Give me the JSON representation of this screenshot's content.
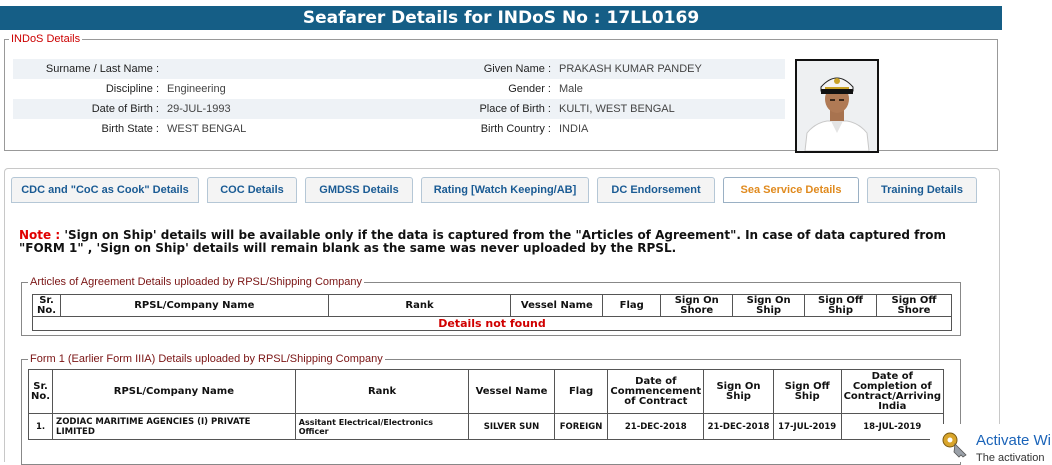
{
  "page_title": "Seafarer Details for INDoS No : 17LL0169",
  "indos": {
    "legend": "INDoS Details",
    "rows": [
      {
        "l1": "Surname / Last Name :",
        "v1": "",
        "l2": "Given Name :",
        "v2": "PRAKASH KUMAR PANDEY"
      },
      {
        "l1": "Discipline :",
        "v1": "Engineering",
        "l2": "Gender :",
        "v2": "Male"
      },
      {
        "l1": "Date of Birth :",
        "v1": "29-JUL-1993",
        "l2": "Place of Birth :",
        "v2": "KULTI, WEST BENGAL"
      },
      {
        "l1": "Birth State :",
        "v1": "WEST BENGAL",
        "l2": "Birth Country :",
        "v2": "INDIA"
      }
    ]
  },
  "tabs": [
    {
      "label": "CDC and \"CoC as Cook\" Details"
    },
    {
      "label": "COC Details"
    },
    {
      "label": "GMDSS Details"
    },
    {
      "label": "Rating [Watch Keeping/AB]"
    },
    {
      "label": "DC Endorsement"
    },
    {
      "label": "Sea Service Details"
    },
    {
      "label": "Training Details"
    }
  ],
  "active_tab": "Sea Service Details",
  "note": {
    "prefix": "Note :",
    "text": " 'Sign on Ship' details will be available only if the data is captured from the \"Articles of Agreement\". In case of data captured from \"FORM 1\" , 'Sign on Ship' details will remain blank as the same was never uploaded by the RPSL."
  },
  "articles": {
    "legend": "Articles of Agreement Details uploaded by RPSL/Shipping Company",
    "headers": [
      "Sr. No.",
      "RPSL/Company Name",
      "Rank",
      "Vessel Name",
      "Flag",
      "Sign On Shore",
      "Sign On Ship",
      "Sign Off Ship",
      "Sign Off Shore"
    ],
    "empty_message": "Details not found"
  },
  "form1": {
    "legend": "Form 1 (Earlier Form IIIA) Details uploaded by RPSL/Shipping Company",
    "headers": [
      "Sr. No.",
      "RPSL/Company Name",
      "Rank",
      "Vessel Name",
      "Flag",
      "Date of Commencement of Contract",
      "Sign On Ship",
      "Sign Off Ship",
      "Date of Completion of Contract/Arriving India"
    ],
    "rows": [
      [
        "1.",
        "ZODIAC MARITIME AGENCIES (I) PRIVATE LIMITED",
        "Assitant Electrical/Electronics Officer",
        "SILVER SUN",
        "FOREIGN",
        "21-DEC-2018",
        "21-DEC-2018",
        "17-JUL-2019",
        "18-JUL-2019"
      ]
    ]
  },
  "activation": {
    "title": "Activate Wi",
    "sub": "The activation"
  },
  "colors": {
    "banner": "#155e86",
    "legend_red": "#cc0000",
    "active_tab": "#e08a1e",
    "tab_text": "#1a5b94",
    "not_found": "#d00000"
  }
}
